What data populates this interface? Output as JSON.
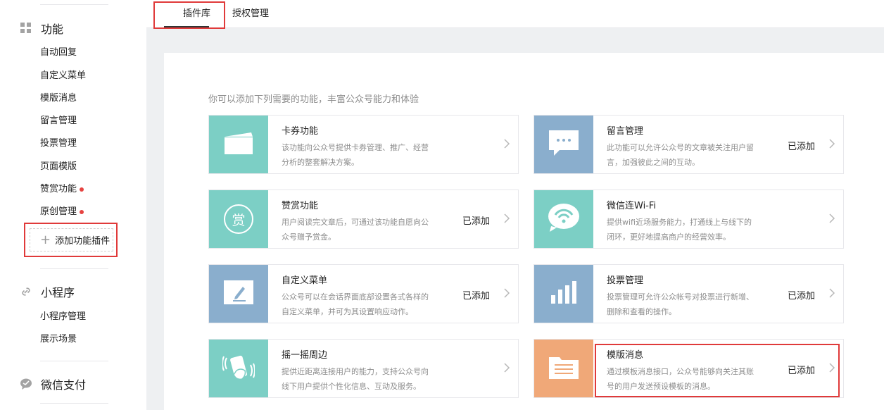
{
  "sidebar": {
    "sections": [
      {
        "label": "功能",
        "icon": "grid-icon"
      },
      {
        "label": "小程序",
        "icon": "link-icon"
      },
      {
        "label": "微信支付",
        "icon": "chat-bubble-icon"
      }
    ],
    "features": [
      "自动回复",
      "自定义菜单",
      "模版消息",
      "留言管理",
      "投票管理",
      "页面模版",
      "赞赏功能",
      "原创管理"
    ],
    "miniprogram_items": [
      "小程序管理",
      "展示场景"
    ],
    "add_plugin_label": "添加功能插件"
  },
  "tabs": [
    "插件库",
    "授权管理"
  ],
  "intro": "你可以添加下列需要的功能，丰富公众号能力和体验",
  "cards": [
    {
      "title": "卡券功能",
      "desc": "该功能向公众号提供卡券管理、推广、经营分析的整套解决方案。",
      "status": "",
      "icon": "card-icon",
      "color": "#7ccfc5"
    },
    {
      "title": "留言管理",
      "desc": "此功能可以允许公众号的文章被关注用户留言，加强彼此之间的互动。",
      "status": "已添加",
      "icon": "comment-icon",
      "color": "#8aaecd"
    },
    {
      "title": "赞赏功能",
      "desc": "用户阅读完文章后，可通过该功能自愿向公众号赠予赏金。",
      "status": "已添加",
      "icon": "reward-icon",
      "color": "#7ccfc5",
      "icon_text": "赏"
    },
    {
      "title": "微信连Wi-Fi",
      "desc": "提供wifi近场服务能力，打通线上与线下的闭环，更好地提高商户的经营效率。",
      "status": "",
      "icon": "wifi-icon",
      "color": "#7ccfc5"
    },
    {
      "title": "自定义菜单",
      "desc": "公众号可以在会话界面底部设置各式各样的自定义菜单，并可为其设置响应动作。",
      "status": "已添加",
      "icon": "edit-icon",
      "color": "#8aaecd"
    },
    {
      "title": "投票管理",
      "desc": "投票管理可允许公众帐号对投票进行新增、删除和查看的操作。",
      "status": "已添加",
      "icon": "bar-chart-icon",
      "color": "#8aaecd"
    },
    {
      "title": "摇一摇周边",
      "desc": "提供近距离连接用户的能力，支持公众号向线下用户提供个性化信息、互动及服务。",
      "status": "",
      "icon": "shake-icon",
      "color": "#7ccfc5"
    },
    {
      "title": "模版消息",
      "desc": "通过模板消息接口，公众号能够向关注其账号的用户发送预设模板的消息。",
      "status": "已添加",
      "icon": "document-icon",
      "color": "#f0a878"
    }
  ]
}
